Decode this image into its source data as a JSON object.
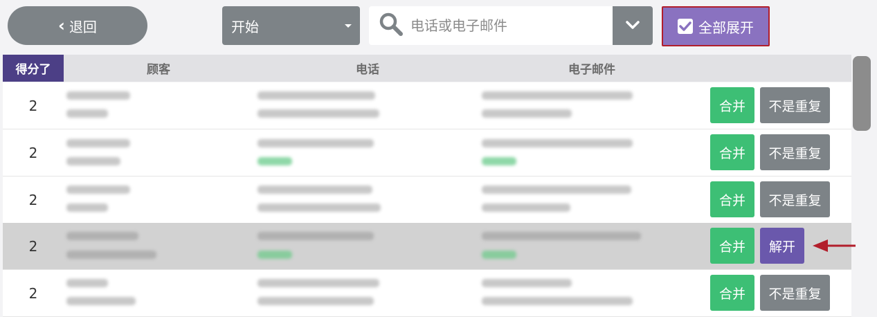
{
  "toolbar": {
    "back_label": "退回",
    "start_select": "开始",
    "search_placeholder": "电话或电子邮件",
    "expand_all_label": "全部展开",
    "expand_all_checked": true
  },
  "table": {
    "headers": {
      "score": "得分了",
      "customer": "顾客",
      "phone": "电话",
      "email": "电子邮件"
    },
    "rows": [
      {
        "score": "2",
        "actions": [
          "合并",
          "不是重复"
        ]
      },
      {
        "score": "2",
        "actions": [
          "合并",
          "不是重复"
        ]
      },
      {
        "score": "2",
        "actions": [
          "合并",
          "不是重复"
        ]
      },
      {
        "score": "2",
        "actions": [
          "合并",
          "解开"
        ]
      },
      {
        "score": "2",
        "actions": [
          "合并",
          "不是重复"
        ]
      }
    ]
  },
  "colors": {
    "gray_button": "#7d8387",
    "accent_purple": "#8a72c0",
    "header_purple": "#4c3f86",
    "merge_green": "#3dbf75",
    "unexpand_purple": "#6a58ac",
    "highlight_red": "#b21e2b"
  }
}
